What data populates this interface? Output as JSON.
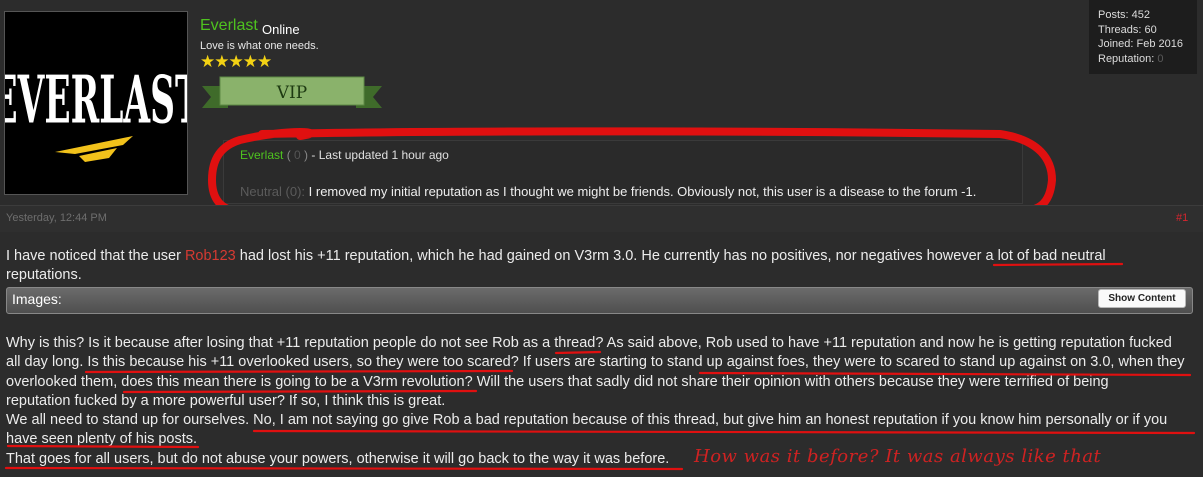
{
  "profile": {
    "avatar_text": "EVERLAST",
    "username": "Everlast",
    "status": "Online",
    "user_title": "Love is what one needs.",
    "stars": "★★★★★",
    "rank_label": "VIP"
  },
  "stats": {
    "posts": "Posts: 452",
    "threads": "Threads: 60",
    "joined": "Joined: Feb 2016",
    "reputation_label": "Reputation: ",
    "reputation_value": "0"
  },
  "reputation_comment": {
    "user": "Everlast",
    "paren_open": " ( ",
    "rep_value": "0",
    "paren_close": " )",
    "updated": " - Last updated 1 hour ago",
    "rating": "Neutral (0):",
    "text": " I removed my initial reputation as I thought we might be friends. Obviously not, this user is a disease to the forum -1."
  },
  "post": {
    "date": "Yesterday, 12:44 PM",
    "number": "#1",
    "p1_a": "I have noticed that the user ",
    "p1_user": "Rob123",
    "p1_b": " had lost his +11 reputation, which he had gained on V3rm 3.0. He currently has no positives, nor negatives however a lot of bad neutral",
    "p1_c": "reputations.",
    "images_label": "Images:",
    "show_content": "Show Content",
    "lines": [
      "Why is this? Is it because after losing that +11 reputation people do not see Rob as a thread? As said above, Rob used to have +11 reputation and now he is getting reputation fucked",
      "all day long. Is this because his +11 overlooked users, so they were too scared? If users are starting to stand up against foes, they were to scared to stand up against on 3.0, when they",
      "overlooked them, does this mean there is going to be a V3rm revolution? Will the users that sadly did not share their opinion with others because they were terrified of being",
      "reputation fucked by a more powerful user? If so, I think this is great.",
      "We all need to stand up for ourselves. No, I am not saying go give Rob a bad reputation because of this thread, but give him an honest reputation if you know him personally or if you",
      "have seen plenty of his posts.",
      "That goes for all users, but do not abuse your powers, otherwise it will go back to the way it was before."
    ]
  },
  "annotation": "How was it before? It was always like that"
}
